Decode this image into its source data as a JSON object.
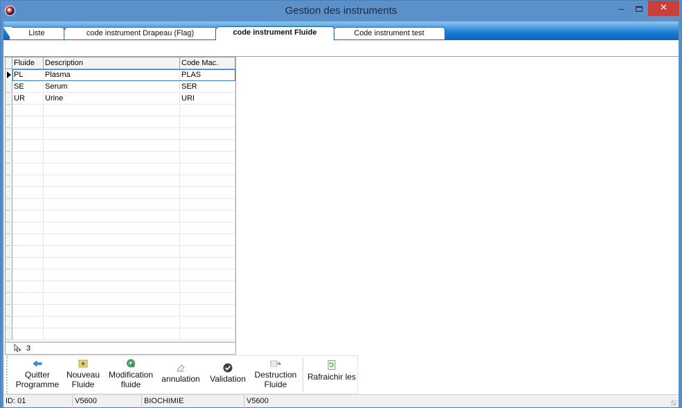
{
  "window": {
    "title": "Gestion des instruments",
    "minimize_glyph": "–",
    "close_glyph": "✕"
  },
  "tabs": [
    {
      "label": "Liste"
    },
    {
      "label": "code instrument Drapeau (Flag)"
    },
    {
      "label": "code instrument Fluide"
    },
    {
      "label": "Code instrument test"
    }
  ],
  "grid": {
    "columns": [
      "Fluide",
      "Description",
      "Code Mac."
    ],
    "rows": [
      {
        "fluide": "PL",
        "description": "Plasma",
        "code": "PLAS"
      },
      {
        "fluide": "SE",
        "description": "Serum",
        "code": "SER"
      },
      {
        "fluide": "UR",
        "description": "Urine",
        "code": "URI"
      }
    ],
    "record_count": "3"
  },
  "toolbar": {
    "quit": "Quitter Programme",
    "new": "Nouveau Fluide",
    "modify": "Modification fluide",
    "cancel": "annulation",
    "validate": "Validation",
    "destroy": "Destruction Fluide",
    "refresh": "Rafraichir les"
  },
  "status": {
    "id": "ID: 01",
    "instrument": "V5600",
    "department": "BIOCHIMIE",
    "model": "V5600"
  }
}
